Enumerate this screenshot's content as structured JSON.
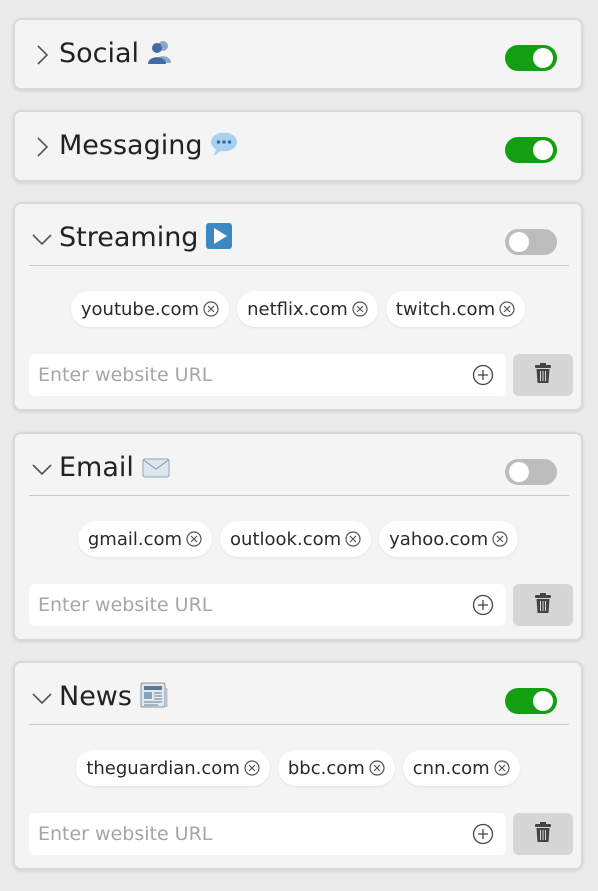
{
  "categories": [
    {
      "name": "Social",
      "emoji_icon": "busts-in-silhouette-icon",
      "expanded": false,
      "enabled": true,
      "sites": []
    },
    {
      "name": "Messaging",
      "emoji_icon": "speech-balloon-icon",
      "expanded": false,
      "enabled": true,
      "sites": []
    },
    {
      "name": "Streaming",
      "emoji_icon": "play-button-icon",
      "expanded": true,
      "enabled": false,
      "sites": [
        "youtube.com",
        "netflix.com",
        "twitch.com"
      ],
      "input_placeholder": "Enter website URL"
    },
    {
      "name": "Email",
      "emoji_icon": "envelope-icon",
      "expanded": true,
      "enabled": false,
      "sites": [
        "gmail.com",
        "outlook.com",
        "yahoo.com"
      ],
      "input_placeholder": "Enter website URL"
    },
    {
      "name": "News",
      "emoji_icon": "newspaper-icon",
      "expanded": true,
      "enabled": true,
      "sites": [
        "theguardian.com",
        "bbc.com",
        "cnn.com"
      ],
      "input_placeholder": "Enter website URL"
    }
  ],
  "colors": {
    "toggle_on": "#12a012",
    "toggle_off": "#bcbcbc",
    "card_bg": "#f4f4f4",
    "page_bg": "#ebebeb"
  }
}
